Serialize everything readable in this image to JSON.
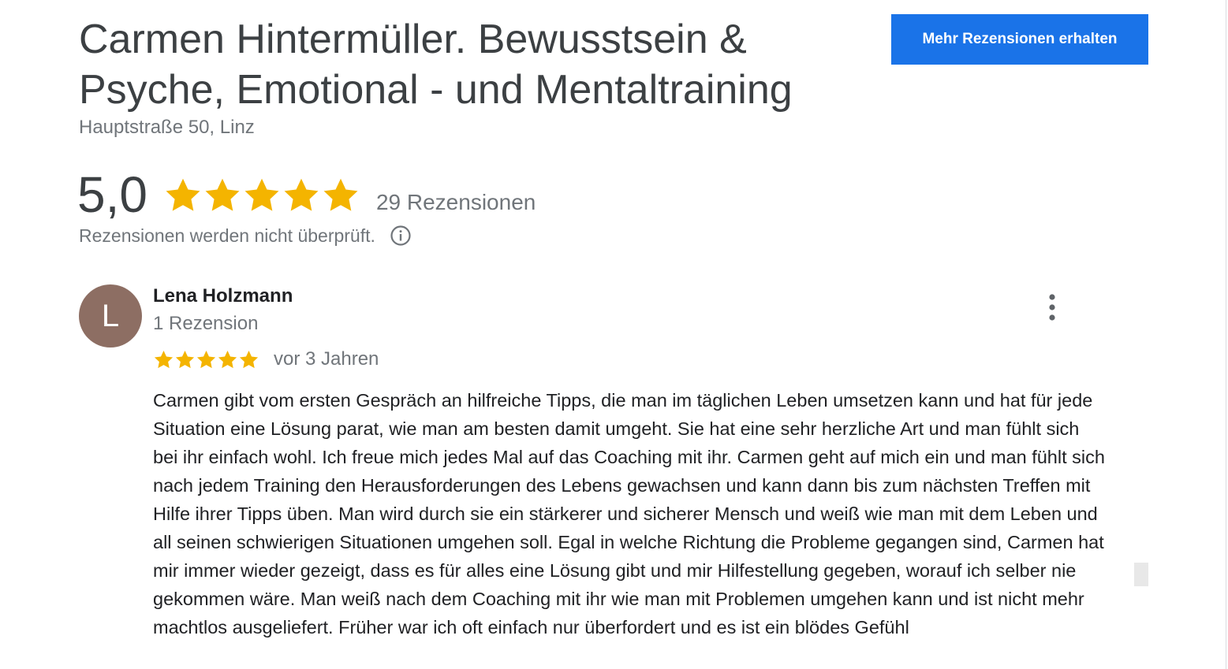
{
  "business": {
    "name": "Carmen Hintermüller. Bewusstsein & Psyche, Emotional - und Mentaltraining",
    "address": "Hauptstraße 50, Linz"
  },
  "actions": {
    "get_more_reviews_label": "Mehr Rezensionen erhalten"
  },
  "rating": {
    "value": "5,0",
    "stars": 5,
    "review_count_label": "29 Rezensionen",
    "disclaimer": "Rezensionen werden nicht überprüft."
  },
  "review": {
    "avatar_letter": "L",
    "reviewer_name": "Lena Holzmann",
    "reviewer_meta": "1 Rezension",
    "stars": 5,
    "date": "vor 3 Jahren",
    "text": "Carmen gibt vom ersten Gespräch an hilfreiche Tipps, die man im täglichen Leben umsetzen kann und hat für jede Situation eine Lösung parat, wie man am besten damit umgeht. Sie hat eine sehr herzliche Art und man fühlt sich bei ihr einfach wohl. Ich freue mich jedes Mal auf das Coaching mit ihr. Carmen geht auf mich ein und man fühlt sich nach jedem Training den Herausforderungen des Lebens gewachsen und kann dann bis zum nächsten Treffen mit Hilfe ihrer Tipps üben. Man wird durch sie ein stärkerer und sicherer Mensch und weiß wie man mit dem Leben und all seinen schwierigen Situationen umgehen soll. Egal in welche Richtung die Probleme gegangen sind, Carmen hat mir immer wieder gezeigt, dass es für alles eine Lösung gibt und mir Hilfestellung gegeben, worauf ich selber nie gekommen wäre. Man weiß nach dem Coaching mit ihr wie man mit Problemen umgehen kann und ist nicht mehr machtlos ausgeliefert. Früher war ich oft einfach nur überfordert und es ist ein blödes Gefühl"
  },
  "icons": {
    "star": "star-icon",
    "info": "info-icon",
    "more": "more-vert-icon"
  },
  "colors": {
    "star": "#f4b400",
    "button": "#1a73e8",
    "avatar": "#8d6e63"
  }
}
